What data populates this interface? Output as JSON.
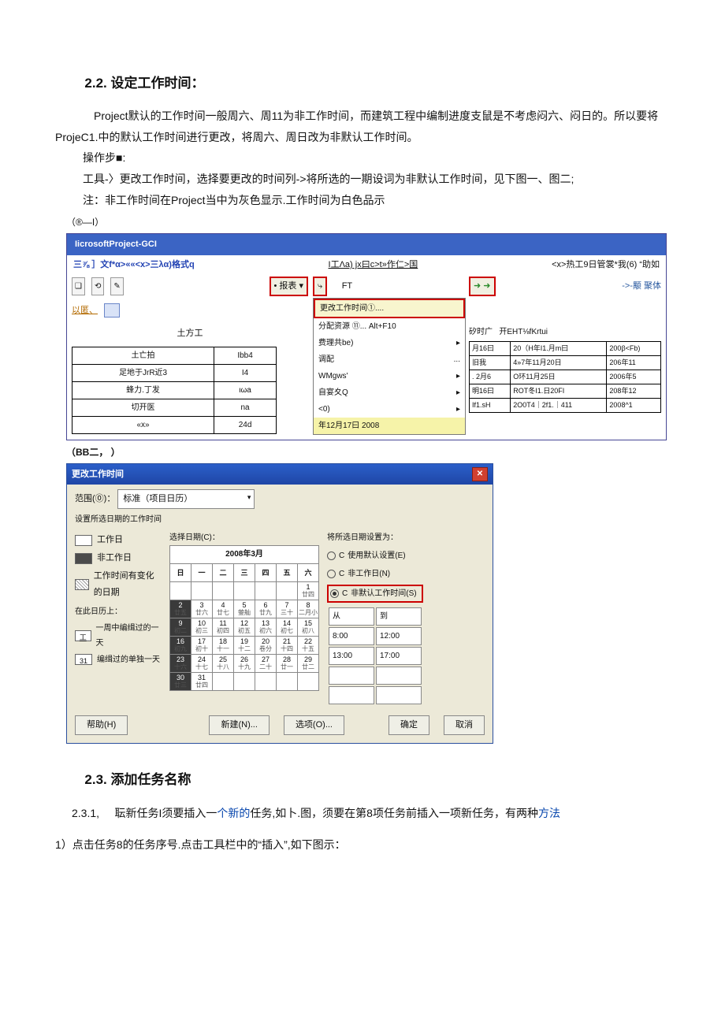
{
  "sec22": {
    "title": "2.2.  设定工作时间：",
    "p1": "Project默认的工作时间一般周六、周11为非工作时间，而建筑工程中编制进度支鼠是不考虑闷六、闷日的。所以要将ProjeC1.中的默认工作时间进行更改，将周六、周日改为非默认工作时间。",
    "p2": "操作步■:",
    "p3": "工具-〉更改工作时间，选择要更改的时间列->将所选的一期设词为非默认工作时间，见下图一、图二;",
    "p4": "注：非工作时间在Project当中为灰色显示.工作时间为白色品示"
  },
  "cap1": "（®—I）",
  "fig1": {
    "title": "IicrosoftProject-GCI",
    "m1": "三⅞ ］文f*α>««<x>三λα)格式q",
    "m2": "I工Λa)  jx曰c>t»作仁>国",
    "m3": "<x>热工9日管裳*我(6) “助如",
    "m4": "->-颙 聚体",
    "reportBtn": "• 报表 ▾",
    "orange": "以匿、",
    "earth": "土方工",
    "dropdown": {
      "a": "更改工作时间①....",
      "b": "分配资源 ⑪...    Alt+F10",
      "c": "费理共be)",
      "d": "调配",
      "e": "WMgws'",
      "f": "自宴夊Q",
      "g": "<0)",
      "h": "年12月17曰      2008"
    },
    "tblA": [
      [
        "土亡拍",
        "Ibb4"
      ],
      [
        "足地于JrR近3",
        "I4"
      ],
      [
        "蜂力.丁发",
        "ιωa"
      ],
      [
        "切开医",
        "na"
      ],
      [
        "«x»",
        "24d"
      ]
    ],
    "rightTop": "开EHT⅛fKrtui",
    "rt1": "矽时广",
    "tblR": [
      [
        "月16曰",
        "20（H年I1.月m曰",
        "200β<Fb)"
      ],
      [
        "旧我",
        "4»7年11月20日",
        "206年11"
      ],
      [
        ". 2月6",
        "O环11月25日",
        "2006年5"
      ],
      [
        "明16曰",
        "ROT冬I1.日20FI",
        "208年12"
      ],
      [
        "If1.sH",
        "2O0T4｜2f1.｜411",
        "2008^1"
      ]
    ]
  },
  "cap2": "（BB二，  ）",
  "fig2": {
    "title": "更改工作时间",
    "scopeLabel": "范围(⓪)：",
    "scopeVal": "标准（项目日历）",
    "setLbl": "设置所选日期的工作时间",
    "selDate": "选择日期(C)：",
    "month": "2008年3月",
    "legend": [
      "工作日",
      "非工作日",
      "工作时间有变化的日期"
    ],
    "onDay": "在此日历上：",
    "l4": "一周中编缉过的一天",
    "l5": "编缉过的单独一天",
    "wh": [
      "日",
      "一",
      "二",
      "三",
      "四",
      "五",
      "六"
    ],
    "row1": [
      "",
      "",
      "",
      "",
      "",
      "",
      "1\n廿四"
    ],
    "row2": [
      "2\n廿五",
      "3\n廿六",
      "4\n廿七",
      "5\n蓥舢",
      "6\n廿九",
      "7\n三十",
      "8\n二月小"
    ],
    "row3": [
      "9\n初二",
      "10\n初三",
      "11\n初四",
      "12\n初五",
      "13\n初六",
      "14\n初七",
      "15\n初八"
    ],
    "row4": [
      "16\n初九",
      "17\n初十",
      "18\n十一",
      "19\n十二",
      "20\n卷分",
      "21\n十四",
      "22\n十五"
    ],
    "row5": [
      "23\n十六",
      "24\n十七",
      "25\n十八",
      "26\n十九",
      "27\n二十",
      "28\n廿一",
      "29\n廿二"
    ],
    "row6": [
      "30\n廿三",
      "31\n廿四",
      "",
      "",
      "",
      "",
      ""
    ],
    "setTo": "将所选日期设置为：",
    "opt1": "使用默认设置(E)",
    "opt2": "非工作日(N)",
    "opt3": "非默认工作时间(S)",
    "from": "从",
    "to": "到",
    "t1": "8:00",
    "t2": "12:00",
    "t3": "13:00",
    "t4": "17:00",
    "btns": [
      "帮助(H)",
      "新建(N)...",
      "选项(O)...",
      "确定",
      "取消"
    ]
  },
  "sec23": {
    "title": "2.3.  添加任务名称",
    "p1a": "2.3.1,",
    "p1b": "耺新任务I须要插入一",
    "p1c": "个新的",
    "p1d": "任务,如卜.图，须要在第8项任务前插入一项新任务，有两种",
    "p1e": "方法",
    "p2": "1）点击任务8的任务序号.点击工具栏中的“插入”,如下图示："
  }
}
